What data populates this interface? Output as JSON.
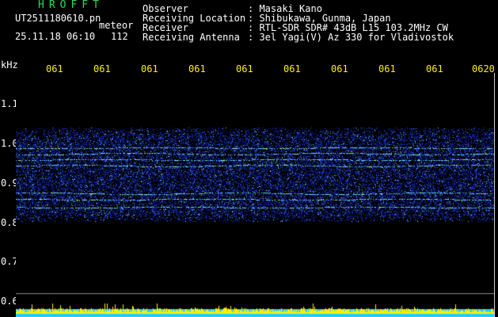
{
  "header": {
    "app_title": "HROFFT",
    "file_name": "UT2511180610.pn",
    "meteor_label": "meteor",
    "date_time": "25.11.18 06:10",
    "count": "112",
    "fields": [
      {
        "label": "Observer",
        "value": ": Masaki Kano"
      },
      {
        "label": "Receiving Location",
        "value": ": Shibukawa, Gunma, Japan"
      },
      {
        "label": "Receiver",
        "value": ": RTL-SDR SDR# 43dB L15 103.2MHz CW"
      },
      {
        "label": "Receiving Antenna",
        "value": ": 3el Yagi(V) Az 330 for Vladivostok"
      }
    ]
  },
  "plot": {
    "y_unit": "kHz",
    "y_ticks": [
      "1.1",
      "1.0",
      "0.9",
      "0.8",
      "0.7",
      "0.6"
    ],
    "x_ticks": [
      "061",
      "061",
      "061",
      "061",
      "061",
      "061",
      "061",
      "061",
      "061",
      "0620"
    ],
    "band_khz": [
      0.8,
      1.0
    ],
    "colors": {
      "deep": "#0a1a8a",
      "mid": "#2244dd",
      "bright": "#66ccff",
      "hot": "#ccff66",
      "bottom_cyan": "#22ccff",
      "bottom_yellow": "#ffee00"
    }
  }
}
